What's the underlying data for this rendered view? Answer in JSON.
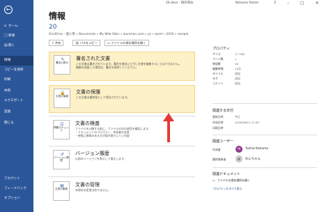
{
  "titlebar": {
    "doc": "20.docx - 保存済み",
    "user": "Kohama Yoshie",
    "controls": "? – ▢ ✕"
  },
  "sidebar": {
    "back_glyph": "←",
    "items": [
      {
        "label": "ホーム",
        "glyph": "⌂"
      },
      {
        "label": "新規",
        "glyph": "▢"
      },
      {
        "label": "開く",
        "glyph": "▤"
      },
      {
        "label": "情報",
        "glyph": ""
      },
      {
        "label": "コピーを保存",
        "glyph": ""
      },
      {
        "label": "印刷",
        "glyph": ""
      },
      {
        "label": "共有",
        "glyph": ""
      },
      {
        "label": "エクスポート",
        "glyph": ""
      },
      {
        "label": "変換",
        "glyph": ""
      },
      {
        "label": "閉じる",
        "glyph": ""
      }
    ],
    "bottom": [
      "アカウント",
      "フィードバック",
      "オプション"
    ]
  },
  "main": {
    "title": "情報",
    "doc_name": "20",
    "path": "OneDrive - 個人用 » Documents » My Web Sites » wanchan.com » pc » word » 2016 » sample",
    "buttons": [
      "共有",
      "パスをコピー",
      "ファイルの保存場所を開く"
    ]
  },
  "cards": [
    {
      "title": "署名された文書",
      "icon_label": "署名の表示",
      "desc": [
        "この文書は署名されています。署名を無効にせずに文書を編集することはできません。",
        "編集を保留した場合は、署名を削除してください。"
      ],
      "highlight": true
    },
    {
      "title": "文書の保護",
      "icon_label": "文書の保護",
      "desc": [
        "この文書は最終版として保存されています。"
      ],
      "highlight": true
    },
    {
      "title": "文書の検査",
      "icon_label": "問題のチェック",
      "desc": [
        "ファイルを公開する前に、ファイルの次の項目を確認します。",
        "・ドキュメントのプロパティ、作成者の名前",
        "・視覚に障碍のある方が読み取りにくい内容"
      ],
      "highlight": false
    },
    {
      "title": "バージョン履歴",
      "icon_label": "バージョン履歴",
      "desc": [
        "以前のバージョンを表示して復元します。"
      ],
      "highlight": false
    },
    {
      "title": "文書の管理",
      "icon_label": "文書の管理",
      "desc": [
        "未保存の変更はありません。"
      ],
      "highlight": false
    }
  ],
  "properties": {
    "heading": "プロパティ",
    "rows": [
      {
        "k": "サイズ",
        "v": "17.7KB"
      },
      {
        "k": "ページ数",
        "v": "1"
      },
      {
        "k": "単語数",
        "v": "48"
      },
      {
        "k": "編集時間",
        "v": "10分"
      },
      {
        "k": "タイトル",
        "v": "追加"
      },
      {
        "k": "タグ",
        "v": "追加"
      },
      {
        "k": "コメント",
        "v": "追加"
      }
    ]
  },
  "dates": {
    "heading": "関連する日付",
    "rows": [
      {
        "k": "更新日時",
        "v": "今日"
      },
      {
        "k": "作成日時",
        "v": "2016/06/12 12:09"
      },
      {
        "k": "印刷日時",
        "v": ""
      }
    ]
  },
  "people": {
    "heading": "関連ユーザー",
    "author_label": "作成者",
    "author_initials": "YK",
    "author_name": "Yoshie Kohama",
    "modifier_label": "最終更新者",
    "modifier_name": "わにちゃん"
  },
  "related_docs": {
    "heading": "関連ドキュメント",
    "open_location": "ファイルの保存場所を開く",
    "show_all": "プロパティをすべて表示"
  },
  "colors": {
    "accent": "#2b579a",
    "highlight": "#fdf1c8",
    "arrow": "#e53935",
    "avatar": "#8e3a8e"
  }
}
